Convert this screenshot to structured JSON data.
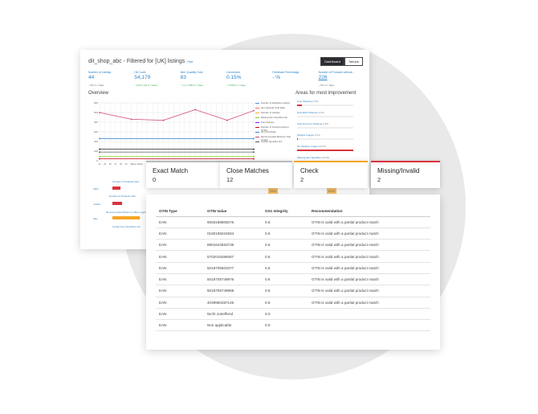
{
  "dashboard": {
    "title": "dit_shop_abc - Filtered for [UK] listings",
    "hint": "Hint",
    "toggle": {
      "dashboard": "Dashboard",
      "tabular": "Tabular"
    },
    "metrics": [
      {
        "label": "Number of Listings",
        "value": "44",
        "change": "↓ 0% in 7 days",
        "dir": "neutral"
      },
      {
        "label": "Hit Count",
        "value": "54,179",
        "change": "↑ 21% in 30 in 7 days",
        "dir": "up"
      },
      {
        "label": "Item Quantity Sold",
        "value": "83",
        "change": "↑ 1 in 1,250 in 7 days",
        "dir": "up"
      },
      {
        "label": "Conversion",
        "value": "0.15%",
        "change": "↑ 0.15% in 7 days",
        "dir": "up"
      },
      {
        "label": "Feedback Percentage",
        "value": "- %",
        "change": "",
        "dir": "neutral"
      },
      {
        "label": "Number of Products without...",
        "value": "226",
        "change": "↓ 0% in 7 days",
        "dir": "neutral",
        "link": true
      }
    ],
    "overview_title": "Overview",
    "areas_title": "Areas for most improvement",
    "legend": [
      {
        "label": "Number of Duplicate Listings",
        "color": "#4a90d9"
      },
      {
        "label": "Item Quantity Sold Daily",
        "color": "#e8746a"
      },
      {
        "label": "Number of Listings",
        "color": "#f5a623"
      },
      {
        "label": "Missing Item Specifics Info",
        "color": "#7ed321"
      },
      {
        "label": "Free Delivery",
        "color": "#9013fe"
      },
      {
        "label": "Number of Products without GTINs",
        "color": "#d0021b"
      },
      {
        "label": "Hit Count Daily",
        "color": "#2a82c9"
      },
      {
        "label": "Recommended Minimum Title Length",
        "color": "#d33f7a"
      },
      {
        "label": "Certain Specifics Incl.",
        "color": "#555555"
      }
    ],
    "improvements": [
      {
        "label": "Free Shipping",
        "pct": "(4.5%)",
        "fill": 0.08
      },
      {
        "label": "Expedited Shipping",
        "pct": "(0.0%)",
        "fill": 0.0
      },
      {
        "label": "Fast and Free Shipping",
        "pct": "(0.0%)",
        "fill": 0.0
      },
      {
        "label": "Multiple Images",
        "pct": "(0.0%)",
        "fill": 0.02
      },
      {
        "label": "No Variation Image",
        "pct": "(100.0%)",
        "fill": 1.0
      },
      {
        "label": "Missing Item Specifics",
        "pct": "(100.0%)",
        "fill": 0.0
      }
    ],
    "bottom": {
      "rows": [
        "Number of Products with...",
        "Recommended Minimum Title Length",
        "Certain Item Specifics Incl."
      ],
      "left_labels": [
        "Valid",
        "Invalid",
        "Max"
      ],
      "pct1": "25%",
      "pct2": "63%"
    }
  },
  "chart_data": {
    "type": "line",
    "x": [
      "24",
      "25",
      "26",
      "27",
      "28",
      "29",
      "30",
      "June 2022",
      "2",
      "3",
      "4",
      "5",
      "6",
      "7",
      "8",
      "9",
      "10",
      "11",
      "12",
      "13",
      "14",
      "15",
      "16",
      "17",
      "18",
      "19",
      "20",
      "21",
      "22",
      "23"
    ],
    "ylim": [
      0,
      600
    ],
    "yticks": [
      "0",
      "100",
      "200",
      "300",
      "400",
      "500",
      "600"
    ],
    "series": [
      {
        "color": "#d33f7a",
        "points": [
          [
            0,
            500
          ],
          [
            6,
            430
          ],
          [
            12,
            420
          ],
          [
            18,
            530
          ],
          [
            24,
            420
          ],
          [
            29,
            520
          ]
        ]
      },
      {
        "color": "#2a82c9",
        "points": [
          [
            0,
            230
          ],
          [
            29,
            230
          ]
        ]
      },
      {
        "color": "#222222",
        "points": [
          [
            0,
            120
          ],
          [
            29,
            120
          ]
        ]
      },
      {
        "color": "#555555",
        "points": [
          [
            0,
            90
          ],
          [
            29,
            90
          ]
        ]
      },
      {
        "color": "#7ed321",
        "points": [
          [
            0,
            44
          ],
          [
            29,
            44
          ]
        ]
      },
      {
        "color": "#d0021b",
        "points": [
          [
            0,
            20
          ],
          [
            29,
            20
          ]
        ]
      }
    ]
  },
  "cards": [
    {
      "title": "Exact Match",
      "count": "0"
    },
    {
      "title": "Close Matches",
      "count": "12"
    },
    {
      "title": "Check",
      "count": "2"
    },
    {
      "title": "Missing/Invalid",
      "count": "2"
    }
  ],
  "table": {
    "headers": [
      "GTIN Type",
      "GTIN Value",
      "GS1 Integrity",
      "Recommendation"
    ],
    "rows": [
      [
        "EAN",
        "6093188805076",
        "0.6",
        "GTIN is valid with a partial product match"
      ],
      [
        "EAN",
        "0190199224594",
        "0.6",
        "GTIN is valid with a partial product match"
      ],
      [
        "EAN",
        "8801643563735",
        "0.6",
        "GTIN is valid with a partial product match"
      ],
      [
        "EAN",
        "5702016389267",
        "0.6",
        "GTIN is valid with a partial product match"
      ],
      [
        "EAN",
        "5018705603377",
        "0.6",
        "GTIN is valid with a partial product match"
      ],
      [
        "EAN",
        "5018705749976",
        "0.6",
        "GTIN is valid with a partial product match"
      ],
      [
        "EAN",
        "5018705749969",
        "0.6",
        "GTIN is valid with a partial product match"
      ],
      [
        "EAN",
        "4039950287146",
        "0.6",
        "GTIN is valid with a partial product match"
      ],
      [
        "EAN",
        "Nicht zutreffend",
        "0.0",
        ""
      ],
      [
        "EAN",
        "Non applicable",
        "0.0",
        ""
      ]
    ]
  }
}
